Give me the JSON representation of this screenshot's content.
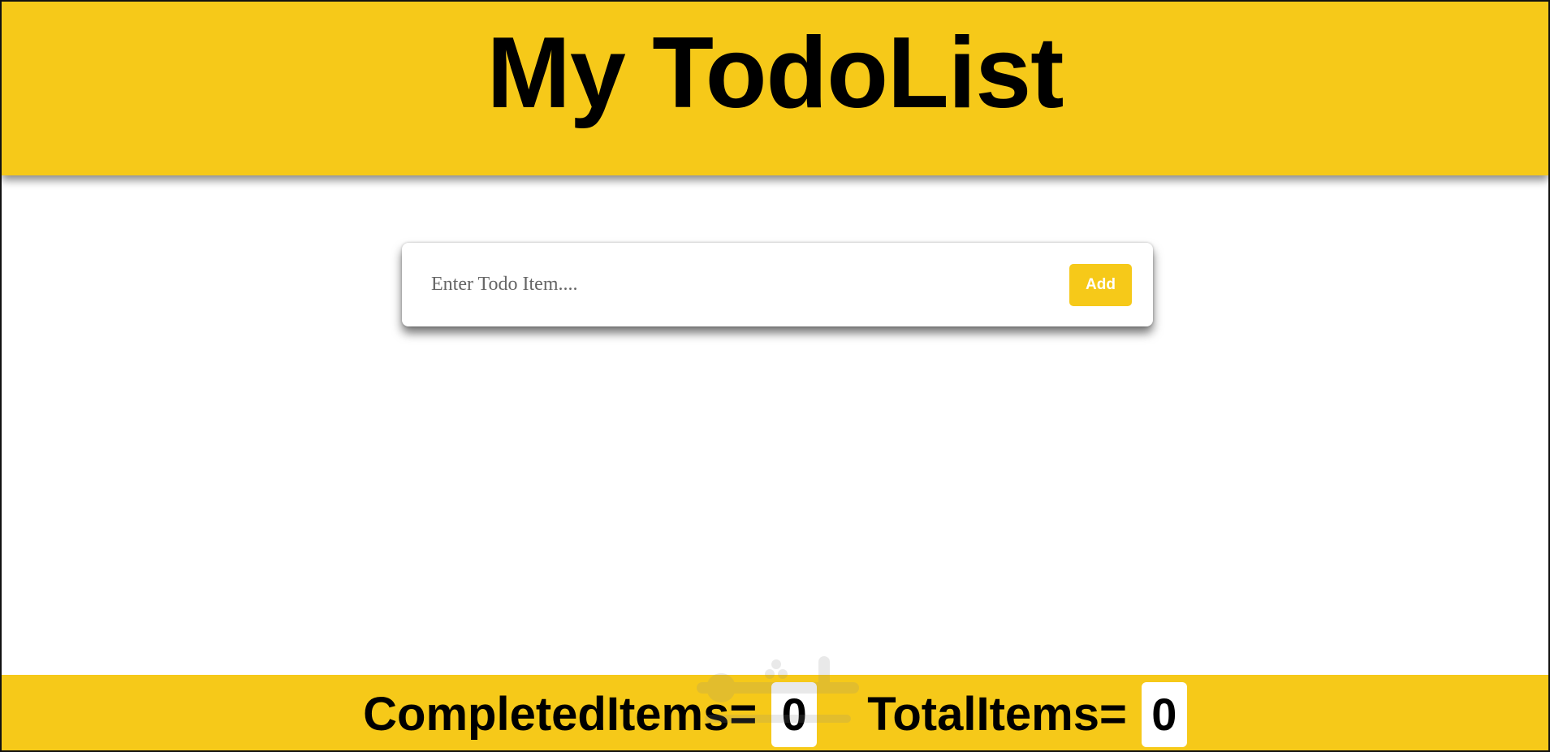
{
  "app": {
    "title": "My TodoList"
  },
  "form": {
    "placeholder": "Enter Todo Item....",
    "value": "",
    "add_label": "Add"
  },
  "stats": {
    "completed_label": "CompletedItems=",
    "completed_value": "0",
    "total_label": "TotalItems=",
    "total_value": "0"
  },
  "colors": {
    "accent": "#f6c919",
    "text": "#000000",
    "background": "#ffffff"
  }
}
